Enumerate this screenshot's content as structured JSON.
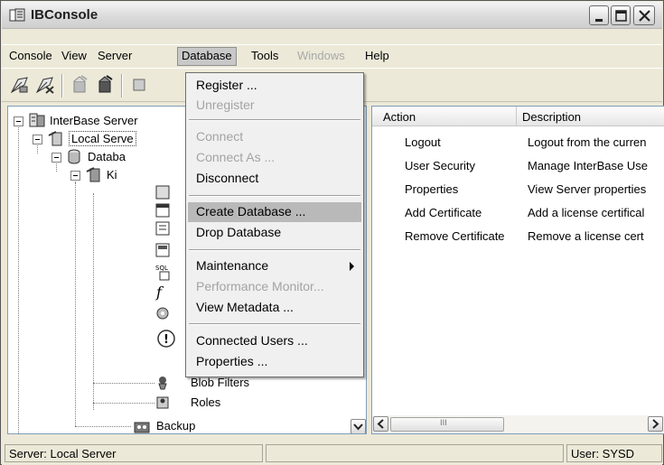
{
  "window": {
    "title": "IBConsole"
  },
  "menubar": {
    "items": [
      {
        "label": "Console"
      },
      {
        "label": "View"
      },
      {
        "label": "Server"
      },
      {
        "label": "Database"
      },
      {
        "label": "Tools"
      },
      {
        "label": "Windows"
      },
      {
        "label": "Help"
      }
    ]
  },
  "tree": {
    "nodes": [
      {
        "label": "InterBase Server"
      },
      {
        "label": "Local Serve"
      },
      {
        "label": "Databa"
      },
      {
        "label": "Ki"
      },
      {
        "label": "Blob Filters"
      },
      {
        "label": "Roles"
      },
      {
        "label": "Backup"
      }
    ]
  },
  "list": {
    "columns": [
      "Action",
      "Description"
    ],
    "rows": [
      {
        "action": "Logout",
        "description": "Logout from the curren"
      },
      {
        "action": "User Security",
        "description": "Manage InterBase Use"
      },
      {
        "action": "Properties",
        "description": "View Server properties"
      },
      {
        "action": "Add Certificate",
        "description": "Add a license certifical"
      },
      {
        "action": "Remove Certificate",
        "description": "Remove a license cert"
      }
    ],
    "scroll_glyph": "III"
  },
  "database_menu": {
    "items": [
      {
        "label": "Register ...",
        "enabled": true
      },
      {
        "label": "Unregister",
        "enabled": false
      },
      {
        "label": "Connect",
        "enabled": false
      },
      {
        "label": "Connect As ...",
        "enabled": false
      },
      {
        "label": "Disconnect",
        "enabled": true
      },
      {
        "label": "Create Database ...",
        "enabled": true,
        "highlighted": true
      },
      {
        "label": "Drop Database",
        "enabled": true
      },
      {
        "label": "Maintenance",
        "enabled": true,
        "submenu": true
      },
      {
        "label": "Performance Monitor...",
        "enabled": false
      },
      {
        "label": "View Metadata ...",
        "enabled": true
      },
      {
        "label": "Connected Users ...",
        "enabled": true
      },
      {
        "label": "Properties ...",
        "enabled": true
      }
    ]
  },
  "statusbar": {
    "server": "Server: Local Server",
    "user": "User: SYSD"
  },
  "colors": {
    "menu_highlight": "#b9b9b9",
    "window_bg": "#ece9d8",
    "pane_border": "#7f9db9"
  },
  "icons": [
    "app-icon",
    "minimize-icon",
    "maximize-icon",
    "close-icon",
    "register-icon",
    "unregister-icon",
    "connect-icon",
    "disconnect-icon",
    "server-icon",
    "database-icon",
    "domain-icon",
    "table-icon",
    "index-icon",
    "view-icon",
    "procedure-icon",
    "function-icon",
    "generator-icon",
    "exception-icon",
    "blob-filter-icon",
    "roles-icon",
    "backup-icon",
    "submenu-arrow-icon"
  ]
}
